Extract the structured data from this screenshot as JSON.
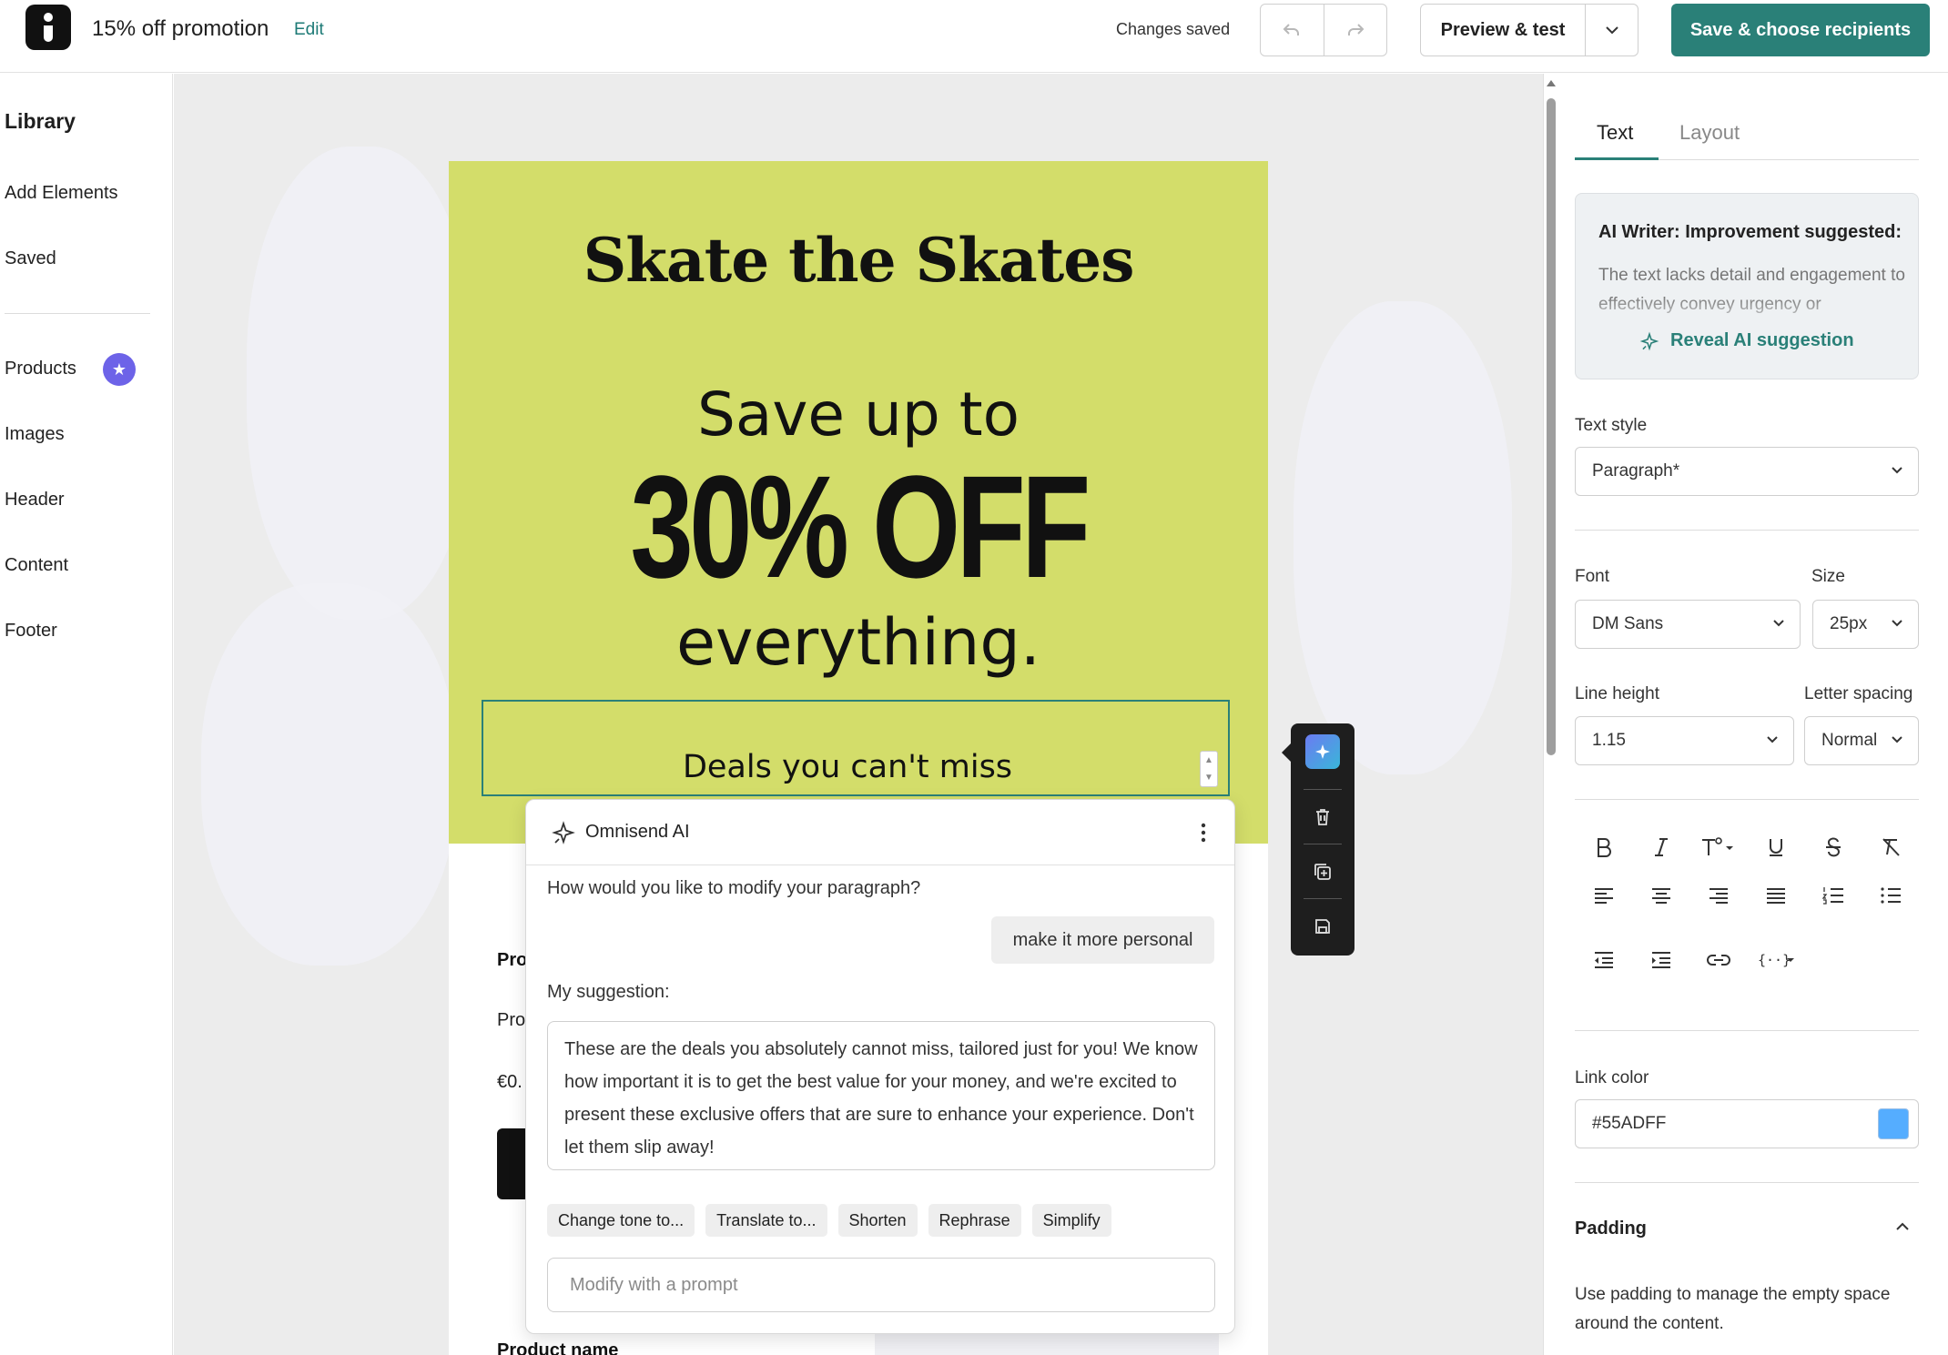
{
  "header": {
    "campaign_title": "15% off promotion",
    "edit_label": "Edit",
    "status": "Changes saved",
    "preview_label": "Preview & test",
    "save_label": "Save & choose recipients"
  },
  "sidebar": {
    "title": "Library",
    "items": [
      {
        "label": "Add Elements"
      },
      {
        "label": "Saved"
      },
      {
        "label": "Products"
      },
      {
        "label": "Images"
      },
      {
        "label": "Header"
      },
      {
        "label": "Content"
      },
      {
        "label": "Footer"
      }
    ]
  },
  "email": {
    "title": "Skate the Skates",
    "save_line": "Save up to",
    "discount": "30% OFF",
    "everything": "everything.",
    "selected_paragraph": "Deals you can't miss",
    "product_bold": "Pro",
    "product_text": "Pro",
    "product_price": "€0.",
    "product_name": "Product name"
  },
  "ai_panel": {
    "title": "Omnisend AI",
    "question": "How would you like to modify your paragraph?",
    "user_prompt": "make it more personal",
    "suggestion_label": "My suggestion:",
    "suggestion": "These are the deals you absolutely cannot miss, tailored just for you! We know how important it is to get the best value for your money, and we're excited to present these exclusive offers that are sure to enhance your experience. Don't let them slip away!",
    "chips": [
      "Change tone to...",
      "Translate to...",
      "Shorten",
      "Rephrase",
      "Simplify"
    ],
    "prompt_placeholder": "Modify with a prompt"
  },
  "right_panel": {
    "tabs": [
      {
        "label": "Text"
      },
      {
        "label": "Layout"
      }
    ],
    "ai_writer": {
      "title": "AI Writer: Improvement suggested:",
      "body": "The text lacks detail and engagement to effectively convey urgency or",
      "reveal_label": "Reveal AI suggestion"
    },
    "text_style": {
      "label": "Text style",
      "value": "Paragraph*"
    },
    "font": {
      "label": "Font",
      "value": "DM Sans"
    },
    "size": {
      "label": "Size",
      "value": "25px"
    },
    "line_height": {
      "label": "Line height",
      "value": "1.15"
    },
    "letter_spacing": {
      "label": "Letter spacing",
      "value": "Normal"
    },
    "link_color": {
      "label": "Link color",
      "value": "#55ADFF"
    },
    "padding": {
      "title": "Padding",
      "description": "Use padding to manage the empty space around the content."
    }
  },
  "colors": {
    "accent": "#2a8078",
    "hero_bg": "#d3dd6a",
    "badge": "#6d63e8",
    "link_swatch": "#55ADFF"
  }
}
